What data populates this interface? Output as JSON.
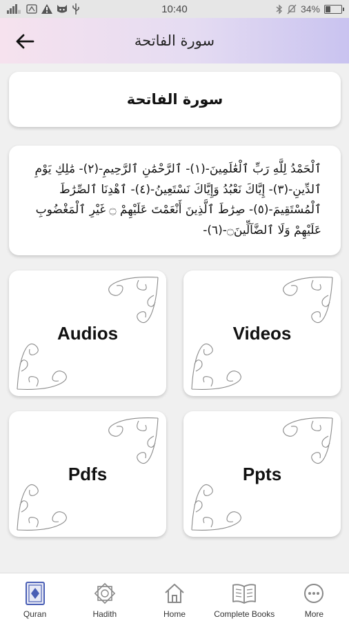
{
  "status_bar": {
    "left_icons": [
      "signal-icon",
      "wifi-icon",
      "warning-icon",
      "cat-icon",
      "usb-icon"
    ],
    "time": "10:40",
    "right_icons": [
      "bluetooth-icon",
      "silent-icon"
    ],
    "battery": "34%",
    "battery_level": 0.34
  },
  "app_bar": {
    "back_icon": "arrow-left-icon",
    "title": "سورة الفاتحة"
  },
  "surah_card": {
    "name": "سورة الفاتحة"
  },
  "ayat_card": {
    "text": "ٱلْحَمْدُ لِلَّهِ رَبِّ ٱلْعَٰلَمِينَ-(١)- ٱلرَّحْمَٰنِ ٱلرَّحِيمِ-(٢)- مَٰلِكِ يَوْمِ ٱلدِّينِ-(٣)- إِيَّاكَ نَعْبُدُ وَإِيَّاكَ نَسْتَعِينُ-(٤)- ٱهْدِنَا ٱلصِّرَٰطَ ٱلْمُسْتَقِيمَ-(٥)- صِرَٰطَ ٱلَّذِينَ أَنْعَمْتَ عَلَيْهِمْ ۝ غَيْرِ ٱلْمَغْضُوبِ عَلَيْهِمْ وَلَا ٱلضَّآلِّينَ۝-(٦)-"
  },
  "tiles": [
    {
      "label": "Audios"
    },
    {
      "label": "Videos"
    },
    {
      "label": "Pdfs"
    },
    {
      "label": "Ppts"
    }
  ],
  "bottom_nav": [
    {
      "label": "Quran",
      "icon": "quran-book-icon",
      "active": true
    },
    {
      "label": "Hadith",
      "icon": "star-emblem-icon",
      "active": false
    },
    {
      "label": "Home",
      "icon": "home-icon",
      "active": false
    },
    {
      "label": "Complete Books",
      "icon": "open-book-icon",
      "active": false
    },
    {
      "label": "More",
      "icon": "more-dots-icon",
      "active": false
    }
  ],
  "colors": {
    "appbar_gradient_start": "#f6e2ee",
    "appbar_gradient_end": "#c9c3f0",
    "background": "#f0f0f0",
    "active_icon": "#4a5fb5"
  }
}
